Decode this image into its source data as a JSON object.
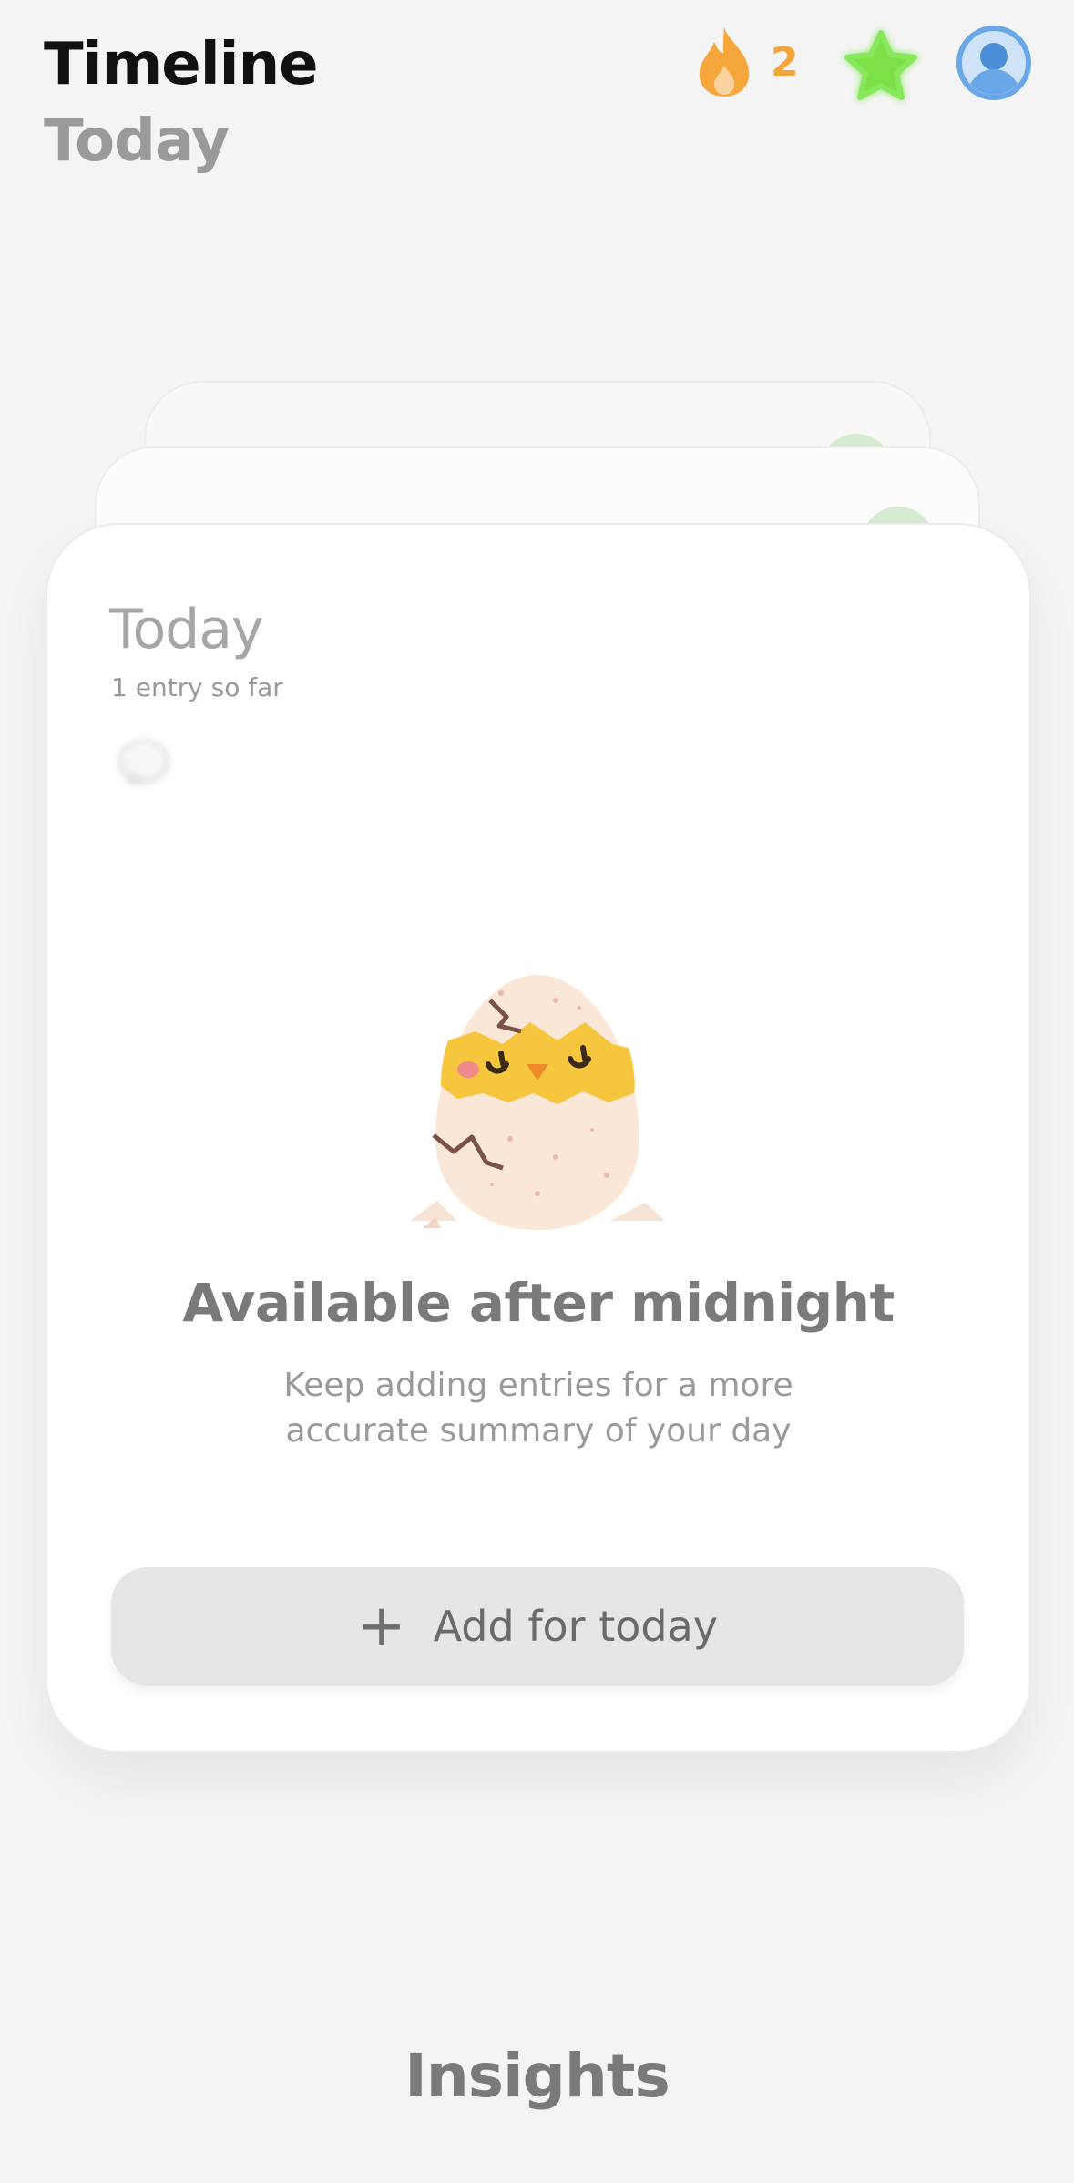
{
  "header": {
    "title": "Timeline",
    "subtitle": "Today",
    "streak": {
      "icon": "flame-icon",
      "count": "2",
      "color": "#f2a53a"
    },
    "star": {
      "icon": "star-icon",
      "color": "#7be04a"
    },
    "profile": {
      "icon": "profile-icon",
      "color": "#4a8fd8"
    }
  },
  "card": {
    "date": "Today",
    "entry_count": "1 entry so far",
    "mood_icon": "mood-blob-icon",
    "illustration": "hatching-chick-egg",
    "empty_title": "Available after midnight",
    "empty_description": "Keep adding entries for a more accurate summary of your day",
    "add_button": {
      "icon": "plus-icon",
      "label": "Add for today"
    }
  },
  "bottom": {
    "section_label": "Insights"
  }
}
